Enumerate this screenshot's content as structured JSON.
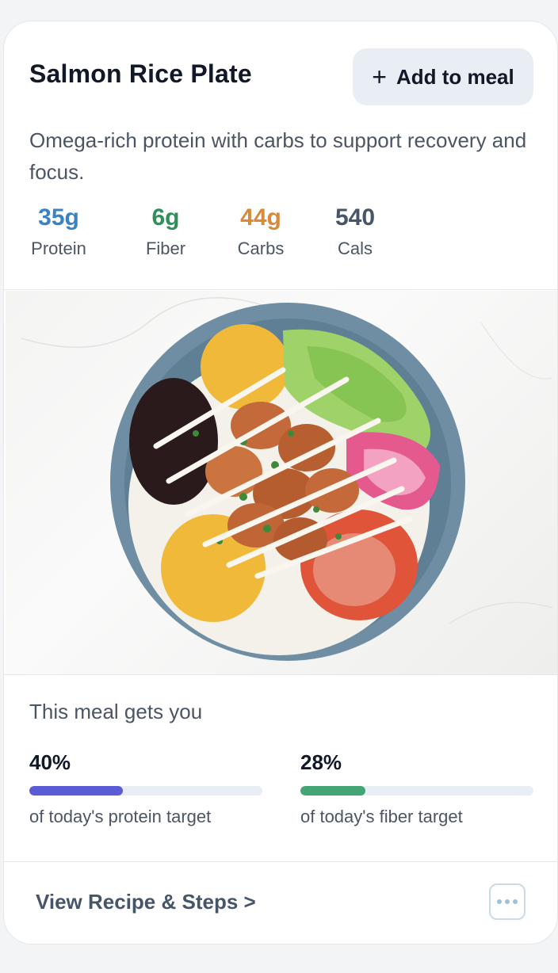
{
  "card": {
    "title": "Salmon Rice Plate",
    "add_button": {
      "icon": "plus-icon",
      "label": "Add to meal"
    },
    "description": "Omega-rich protein with carbs to support recovery and focus.",
    "stats": [
      {
        "value": "35g",
        "label": "Protein",
        "color": "#3b82c4"
      },
      {
        "value": "6g",
        "label": "Fiber",
        "color": "#2f8f5b"
      },
      {
        "value": "44g",
        "label": "Carbs",
        "color": "#d9893a"
      },
      {
        "value": "540",
        "label": "Cals",
        "color": "#475569"
      }
    ],
    "image": {
      "subject": "rice bowl with shrimp, corn, black beans, lettuce, pickled onions and pico de gallo"
    },
    "gets_heading": "This meal gets you",
    "progress": [
      {
        "percent_label": "40%",
        "fraction": 0.4,
        "caption": "of today's protein target",
        "color": "#5b5bd6"
      },
      {
        "percent_label": "28%",
        "fraction": 0.28,
        "caption": "of today's fiber target",
        "color": "#43a574"
      }
    ],
    "recipe_link": "View Recipe & Steps >",
    "more_button": {
      "icon": "more-dots-icon"
    }
  }
}
